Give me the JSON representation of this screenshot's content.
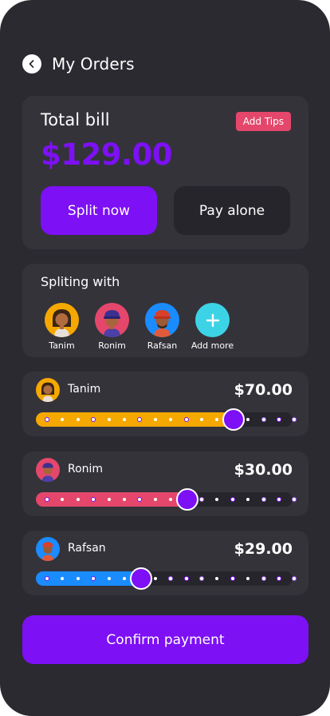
{
  "header": {
    "title": "My Orders",
    "back_icon": "chevron-left-icon"
  },
  "bill": {
    "title": "Total bill",
    "tips_label": "Add Tips",
    "amount": "$129.00",
    "split_label": "Split now",
    "alone_label": "Pay alone"
  },
  "splitting": {
    "title": "Spliting with",
    "people": [
      {
        "name": "Tanim",
        "color": "#f5a800"
      },
      {
        "name": "Ronim",
        "color": "#e4476b"
      },
      {
        "name": "Rafsan",
        "color": "#1a8cff"
      }
    ],
    "add_label": "Add more",
    "add_icon": "plus-icon"
  },
  "shares": [
    {
      "name": "Tanim",
      "amount": "$70.00",
      "fraction": 0.77,
      "color": "#f5a800"
    },
    {
      "name": "Ronim",
      "amount": "$30.00",
      "fraction": 0.59,
      "color": "#e4476b"
    },
    {
      "name": "Rafsan",
      "amount": "$29.00",
      "fraction": 0.41,
      "color": "#1a8cff"
    }
  ],
  "confirm_label": "Confirm payment",
  "colors": {
    "accent": "#7d10f5",
    "background": "#2b2a30",
    "card": "#34333a",
    "tips": "#e4476b"
  }
}
